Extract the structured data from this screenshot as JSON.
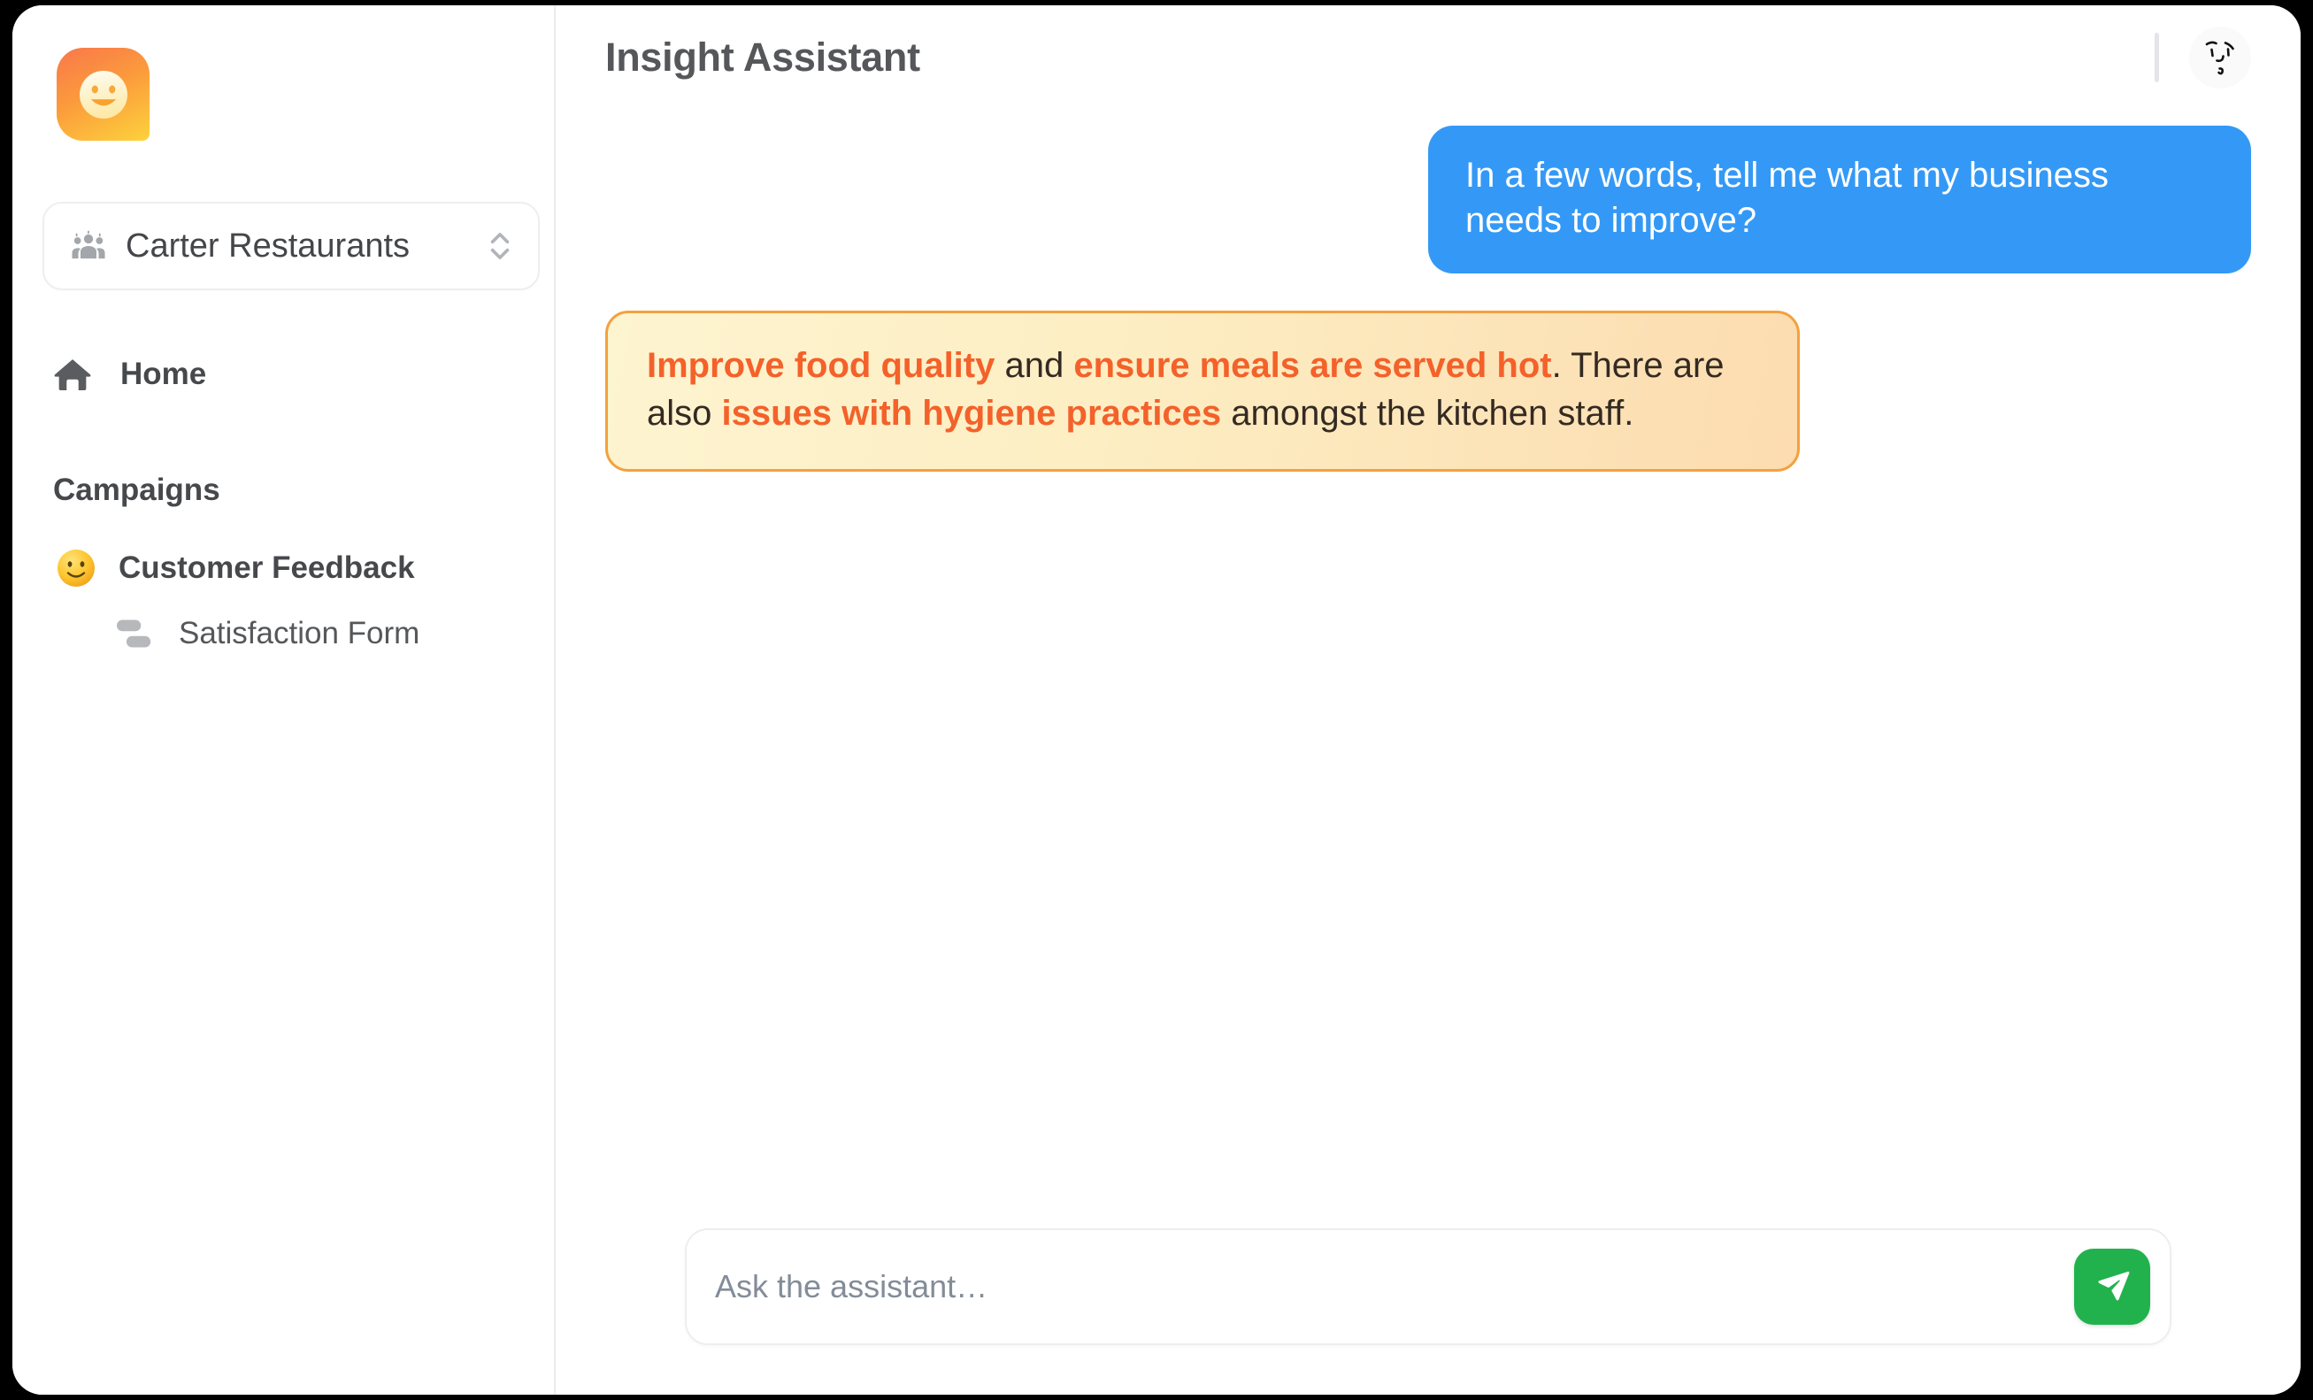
{
  "app": {
    "logo_icon": "smiley-logo-icon"
  },
  "sidebar": {
    "workspace": {
      "icon": "people-group-icon",
      "name": "Carter Restaurants",
      "selector_icon": "up-down-chevrons-icon"
    },
    "nav": [
      {
        "icon": "home-icon",
        "label": "Home"
      }
    ],
    "sections": [
      {
        "title": "Campaigns",
        "items": [
          {
            "emoji": "slightly-smiling-face-emoji",
            "label": "Customer Feedback",
            "children": [
              {
                "icon": "form-icon",
                "label": "Satisfaction Form"
              }
            ]
          }
        ]
      }
    ]
  },
  "header": {
    "title": "Insight Assistant",
    "avatar_icon": "doodle-face-avatar-icon"
  },
  "chat": {
    "user_message": "In a few words, tell me what my business needs to improve?",
    "assistant_message": {
      "segments": [
        {
          "text": "Improve food quality",
          "highlight": true
        },
        {
          "text": " and ",
          "highlight": false
        },
        {
          "text": "ensure meals are served hot",
          "highlight": true
        },
        {
          "text": ". There are also ",
          "highlight": false
        },
        {
          "text": "issues with hygiene practices",
          "highlight": true
        },
        {
          "text": " amongst the kitchen staff.",
          "highlight": false
        }
      ]
    }
  },
  "composer": {
    "placeholder": "Ask the assistant…",
    "value": "",
    "send_icon": "send-paper-plane-icon"
  },
  "colors": {
    "user_bubble": "#3499f6",
    "assistant_bubble_start": "#fdf4d0",
    "assistant_bubble_end": "#fcdcb0",
    "assistant_border": "#f3a13e",
    "highlight_text": "#f4612a",
    "send_button": "#22b24d",
    "logo_gradient_start": "#f9774b",
    "logo_gradient_end": "#fdd23c"
  }
}
